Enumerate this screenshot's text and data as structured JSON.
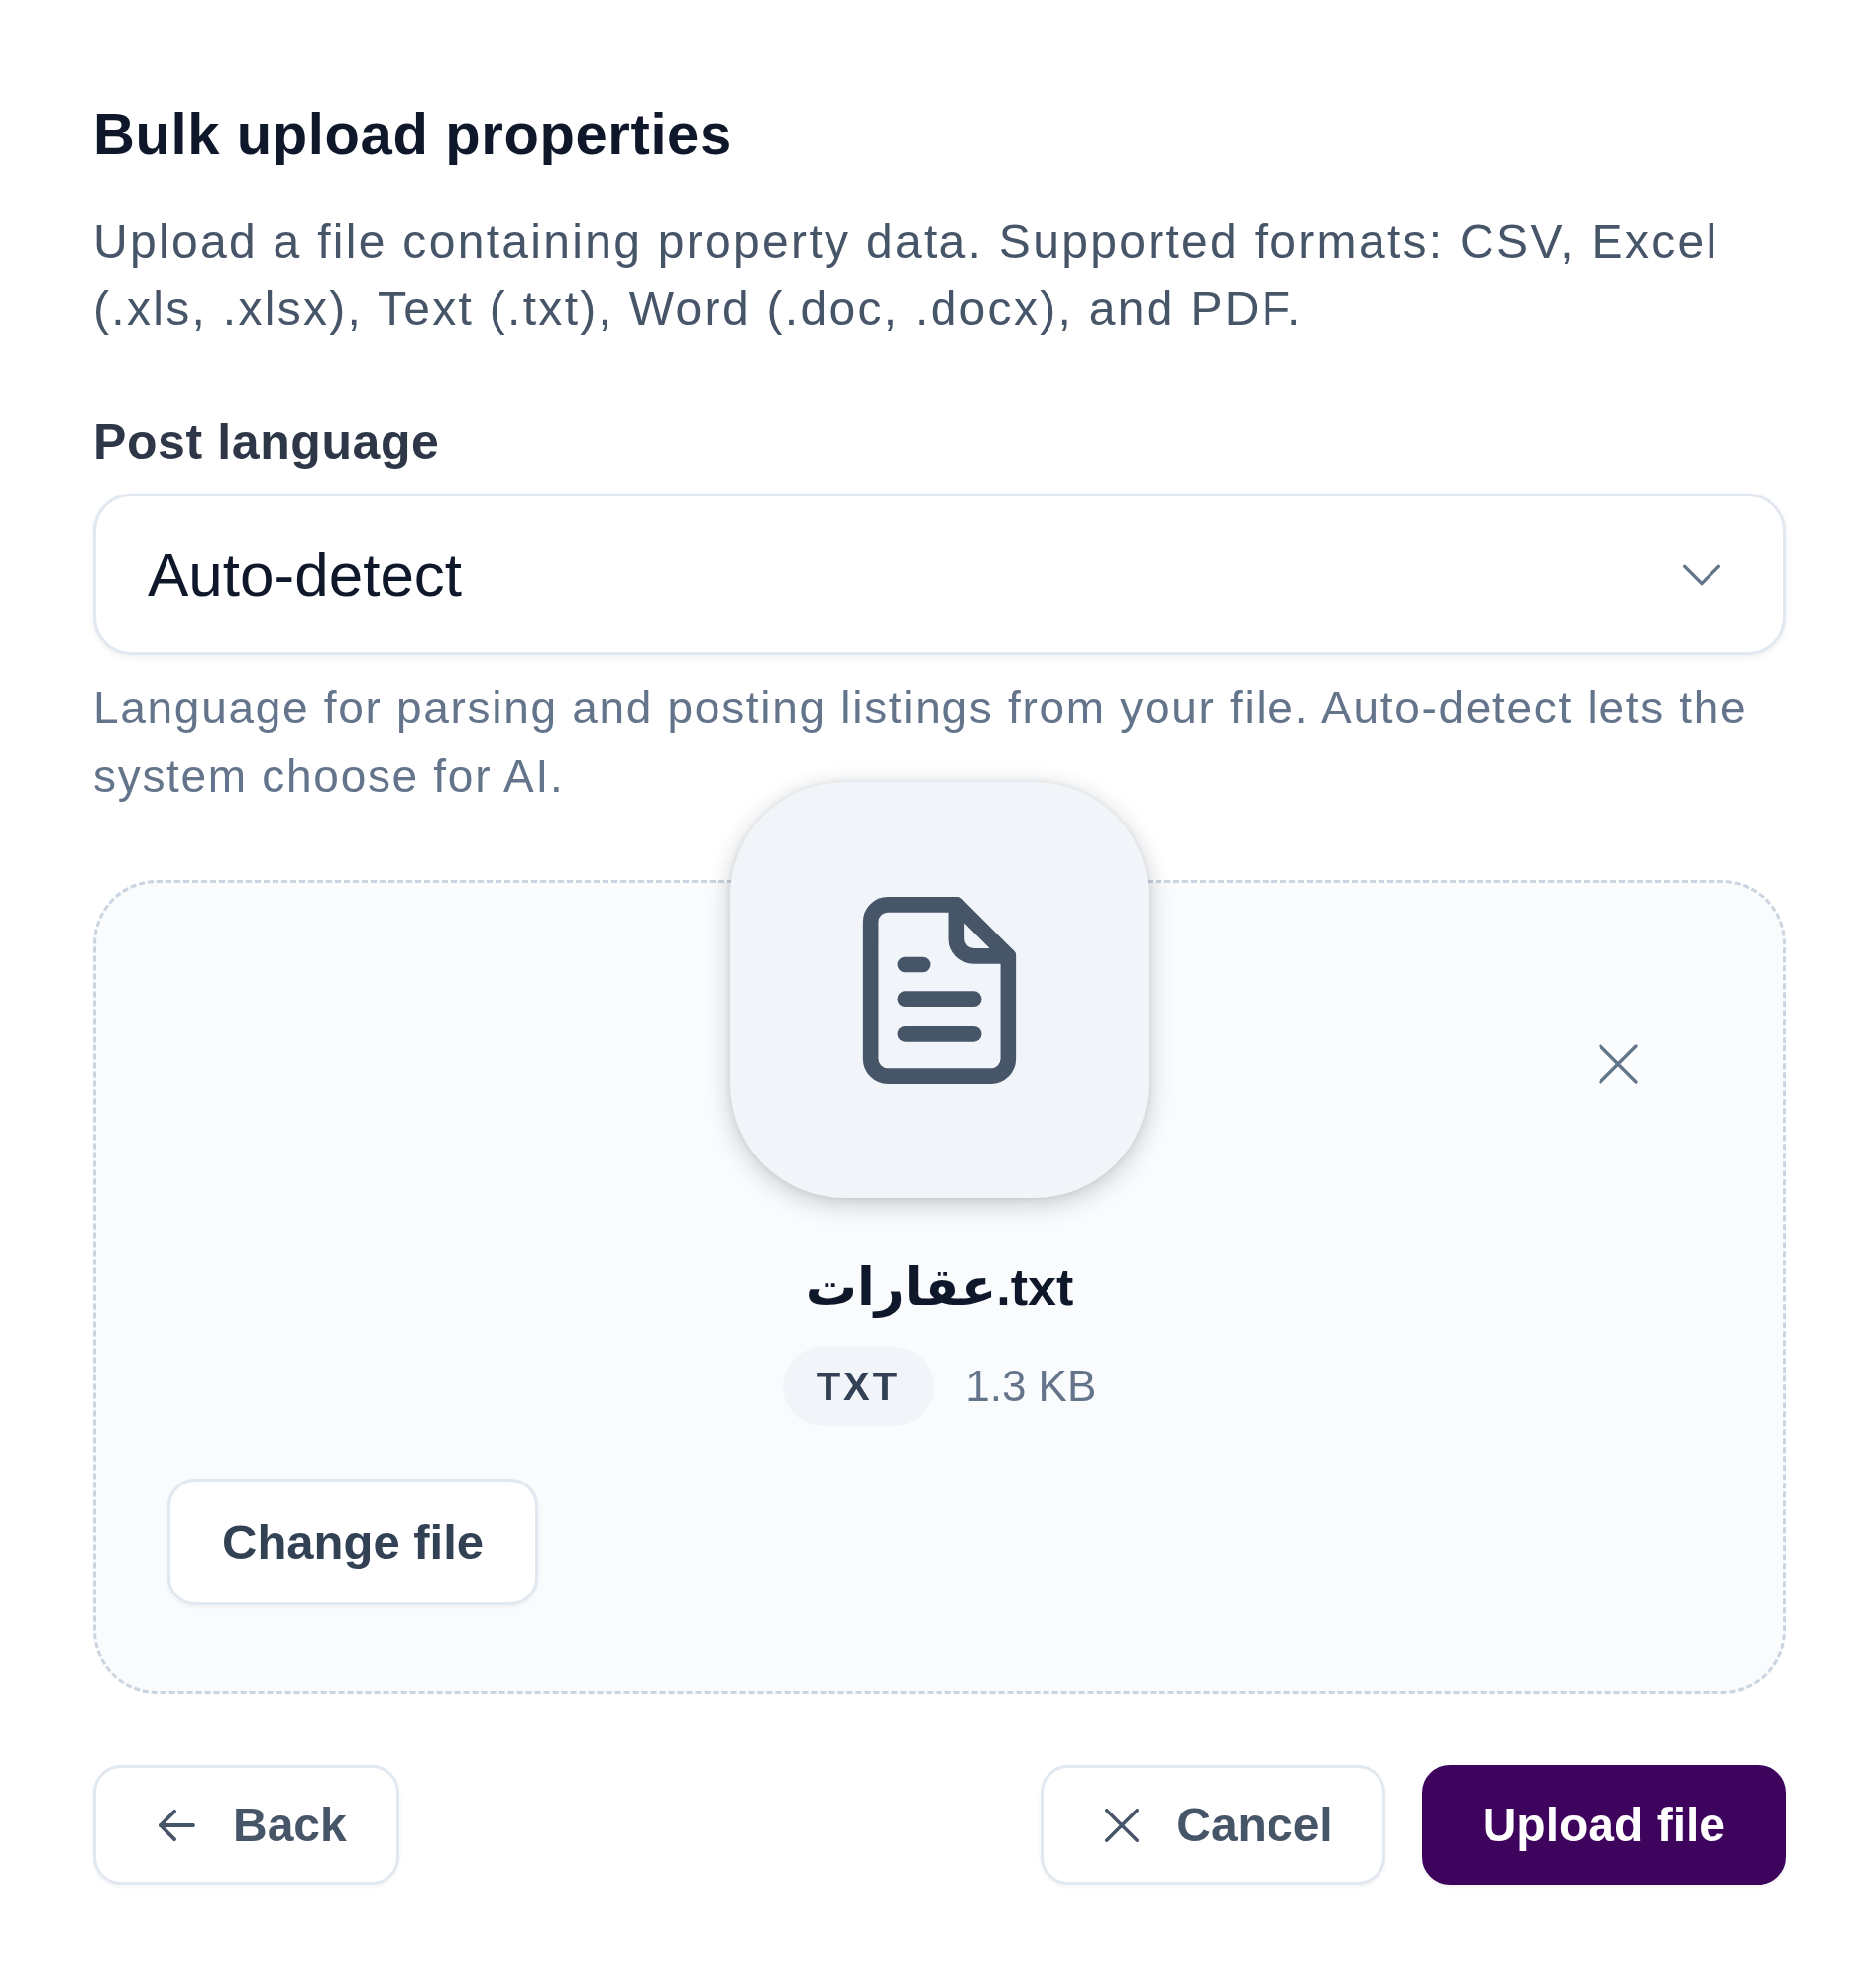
{
  "dialog": {
    "title": "Bulk upload properties",
    "description": "Upload a file containing property data. Supported formats: CSV, Excel (.xls, .xlsx), Text (.txt), Word (.doc, .docx), and PDF."
  },
  "language_field": {
    "label": "Post language",
    "value": "Auto-detect",
    "help": "Language for parsing and posting listings from your file. Auto-detect lets the system choose for AI."
  },
  "upload": {
    "file_name": "عقارات.txt",
    "file_type": "TXT",
    "file_size": "1.3 KB",
    "change_label": "Change file"
  },
  "footer_left": [
    {
      "kind": "back",
      "label": "Back"
    }
  ],
  "footer_right": [
    {
      "kind": "cancel",
      "label": "Cancel"
    },
    {
      "kind": "submit",
      "label": "Upload file"
    }
  ]
}
